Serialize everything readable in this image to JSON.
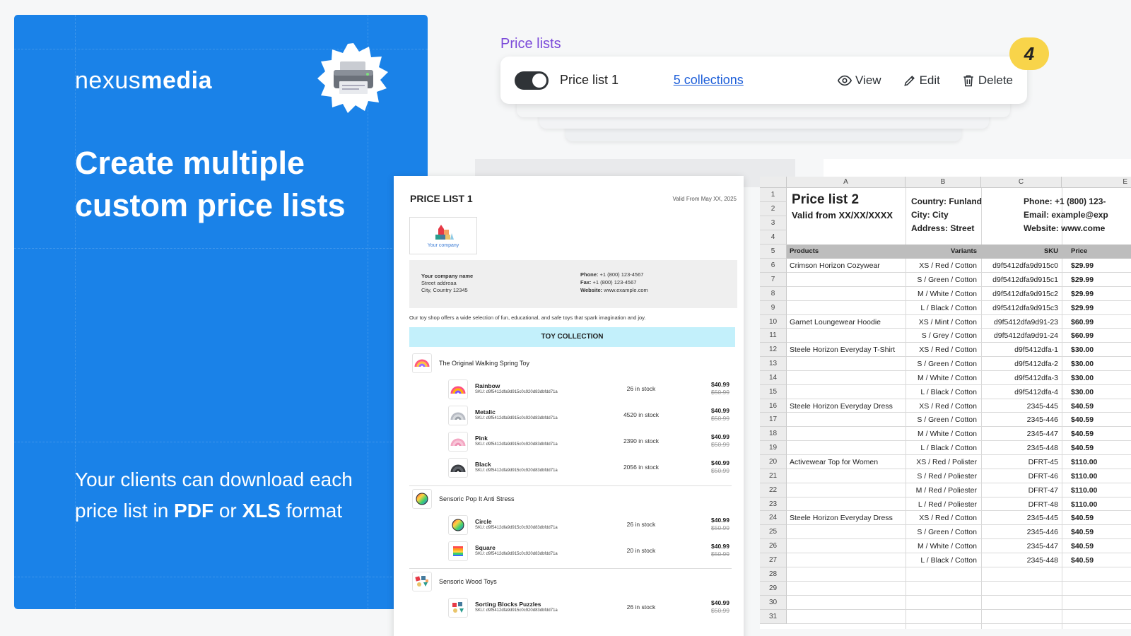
{
  "promo": {
    "logo_thin": "nexus",
    "logo_bold": "media",
    "headline": "Create multiple custom price lists",
    "sub_1": "Your clients can download each price list in ",
    "sub_pdf": "PDF",
    "sub_or": " or ",
    "sub_xls": "XLS",
    "sub_2": " format"
  },
  "price_lists": {
    "title": "Price lists",
    "name": "Price list 1",
    "collections_link": "5 collections",
    "view": "View",
    "edit": "Edit",
    "delete": "Delete",
    "step": "4",
    "toggle_on": true
  },
  "pdf": {
    "title": "PRICE LIST 1",
    "valid": "Valid From May XX, 2025",
    "logo_text": "Your company",
    "company_name": "Your company name",
    "street": "Street addreaa",
    "city": "City, Country 12345",
    "phone_label": "Phone:",
    "phone": "+1 (800) 123-4567",
    "fax_label": "Fax:",
    "fax": "+1 (800) 123-4567",
    "website_label": "Website:",
    "website": "www.example.com",
    "description": "Our toy shop offers a wide selection of fun, educational, and safe toys that spark imagination and joy.",
    "collection": "TOY COLLECTION",
    "products": [
      {
        "name": "The Original Walking Spring Toy"
      },
      {
        "name": "Sensoric Pop It Anti Stress"
      },
      {
        "name": "Sensoric Wood Toys"
      }
    ],
    "variants": [
      {
        "name": "Rainbow",
        "sku": "SKU: d9f5412dfa9d915c0c920d83dbfdd71a",
        "stock": "26 in stock",
        "price": "$40.99",
        "old": "$50.99"
      },
      {
        "name": "Metalic",
        "sku": "SKU: d9f5412dfa9d915c0c920d83dbfdd71a",
        "stock": "4520 in stock",
        "price": "$40.99",
        "old": "$50.99"
      },
      {
        "name": "Pink",
        "sku": "SKU: d9f5412dfa9d915c0c920d83dbfdd71a",
        "stock": "2390 in stock",
        "price": "$40.99",
        "old": "$50.99"
      },
      {
        "name": "Black",
        "sku": "SKU: d9f5412dfa9d915c0c920d83dbfdd71a",
        "stock": "2056 in stock",
        "price": "$40.99",
        "old": "$50.99"
      },
      {
        "name": "Circle",
        "sku": "SKU: d9f5412dfa9d915c0c920d83dbfdd71a",
        "stock": "26 in stock",
        "price": "$40.99",
        "old": "$50.99"
      },
      {
        "name": "Square",
        "sku": "SKU: d9f5412dfa9d915c0c920d83dbfdd71a",
        "stock": "20 in stock",
        "price": "$40.99",
        "old": "$50.99"
      },
      {
        "name": "Sorting Blocks Puzzles",
        "sku": "SKU: d9f5412dfa9d915c0c920d83dbfdd71a",
        "stock": "26 in stock",
        "price": "$40.99",
        "old": "$50.99"
      }
    ]
  },
  "xls": {
    "columns": [
      "A",
      "B",
      "C",
      "E"
    ],
    "title": "Price list 2",
    "valid": "Valid from XX/XX/XXXX",
    "country": "Country: Funland",
    "city": "City: City",
    "address": "Address: Street",
    "phone": "Phone: +1 (800) 123-",
    "email": "Email: example@exp",
    "website": "Website: www.come",
    "headers": {
      "products": "Products",
      "variants": "Variants",
      "sku": "SKU",
      "price": "Price"
    },
    "rows": [
      {
        "product": "Crimson Horizon Cozywear",
        "variant": "XS / Red / Cotton",
        "sku": "d9f5412dfa9d915c0",
        "price": "$29.99"
      },
      {
        "product": "",
        "variant": "S / Green / Cotton",
        "sku": "d9f5412dfa9d915c1",
        "price": "$29.99"
      },
      {
        "product": "",
        "variant": "M / White / Cotton",
        "sku": "d9f5412dfa9d915c2",
        "price": "$29.99"
      },
      {
        "product": "",
        "variant": "L / Black / Cotton",
        "sku": "d9f5412dfa9d915c3",
        "price": "$29.99"
      },
      {
        "product": "Garnet Loungewear Hoodie",
        "variant": "XS / Mint / Cotton",
        "sku": "d9f5412dfa9d91-23",
        "price": "$60.99"
      },
      {
        "product": "",
        "variant": "S / Grey / Cotton",
        "sku": "d9f5412dfa9d91-24",
        "price": "$60.99"
      },
      {
        "product": "Steele Horizon Everyday T-Shirt",
        "variant": "XS / Red / Cotton",
        "sku": "d9f5412dfa-1",
        "price": "$30.00"
      },
      {
        "product": "",
        "variant": "S / Green / Cotton",
        "sku": "d9f5412dfa-2",
        "price": "$30.00"
      },
      {
        "product": "",
        "variant": "M / White / Cotton",
        "sku": "d9f5412dfa-3",
        "price": "$30.00"
      },
      {
        "product": "",
        "variant": "L / Black / Cotton",
        "sku": "d9f5412dfa-4",
        "price": "$30.00"
      },
      {
        "product": "Steele Horizon Everyday Dress",
        "variant": "XS / Red / Cotton",
        "sku": "2345-445",
        "price": "$40.59"
      },
      {
        "product": "",
        "variant": "S / Green / Cotton",
        "sku": "2345-446",
        "price": "$40.59"
      },
      {
        "product": "",
        "variant": "M / White / Cotton",
        "sku": "2345-447",
        "price": "$40.59"
      },
      {
        "product": "",
        "variant": "L / Black / Cotton",
        "sku": "2345-448",
        "price": "$40.59"
      },
      {
        "product": "Activewear Top for Women",
        "variant": "XS / Red / Polister",
        "sku": "DFRT-45",
        "price": "$110.00"
      },
      {
        "product": "",
        "variant": "S / Red / Poliester",
        "sku": "DFRT-46",
        "price": "$110.00"
      },
      {
        "product": "",
        "variant": "M / Red / Poliester",
        "sku": "DFRT-47",
        "price": "$110.00"
      },
      {
        "product": "",
        "variant": "L / Red / Poliester",
        "sku": "DFRT-48",
        "price": "$110.00"
      },
      {
        "product": "Steele Horizon Everyday Dress",
        "variant": "XS / Red / Cotton",
        "sku": "2345-445",
        "price": "$40.59"
      },
      {
        "product": "",
        "variant": "S / Green / Cotton",
        "sku": "2345-446",
        "price": "$40.59"
      },
      {
        "product": "",
        "variant": "M / White / Cotton",
        "sku": "2345-447",
        "price": "$40.59"
      },
      {
        "product": "",
        "variant": "L / Black / Cotton",
        "sku": "2345-448",
        "price": "$40.59"
      }
    ],
    "row_numbers": [
      "1",
      "2",
      "3",
      "4",
      "5",
      "6",
      "7",
      "8",
      "9",
      "10",
      "11",
      "12",
      "13",
      "14",
      "15",
      "16",
      "17",
      "18",
      "19",
      "20",
      "21",
      "22",
      "23",
      "24",
      "25",
      "26",
      "27",
      "28",
      "29",
      "30",
      "31"
    ]
  },
  "colors": {
    "promo_blue": "#1a82e8",
    "accent_purple": "#7b4ad9",
    "link_blue": "#1e5fd9",
    "step_yellow": "#f8d44a",
    "collection_cyan": "#c3f0fb"
  },
  "icons": {
    "badge": "printer-icon",
    "view": "eye-icon",
    "edit": "pencil-icon",
    "delete": "trash-icon"
  }
}
